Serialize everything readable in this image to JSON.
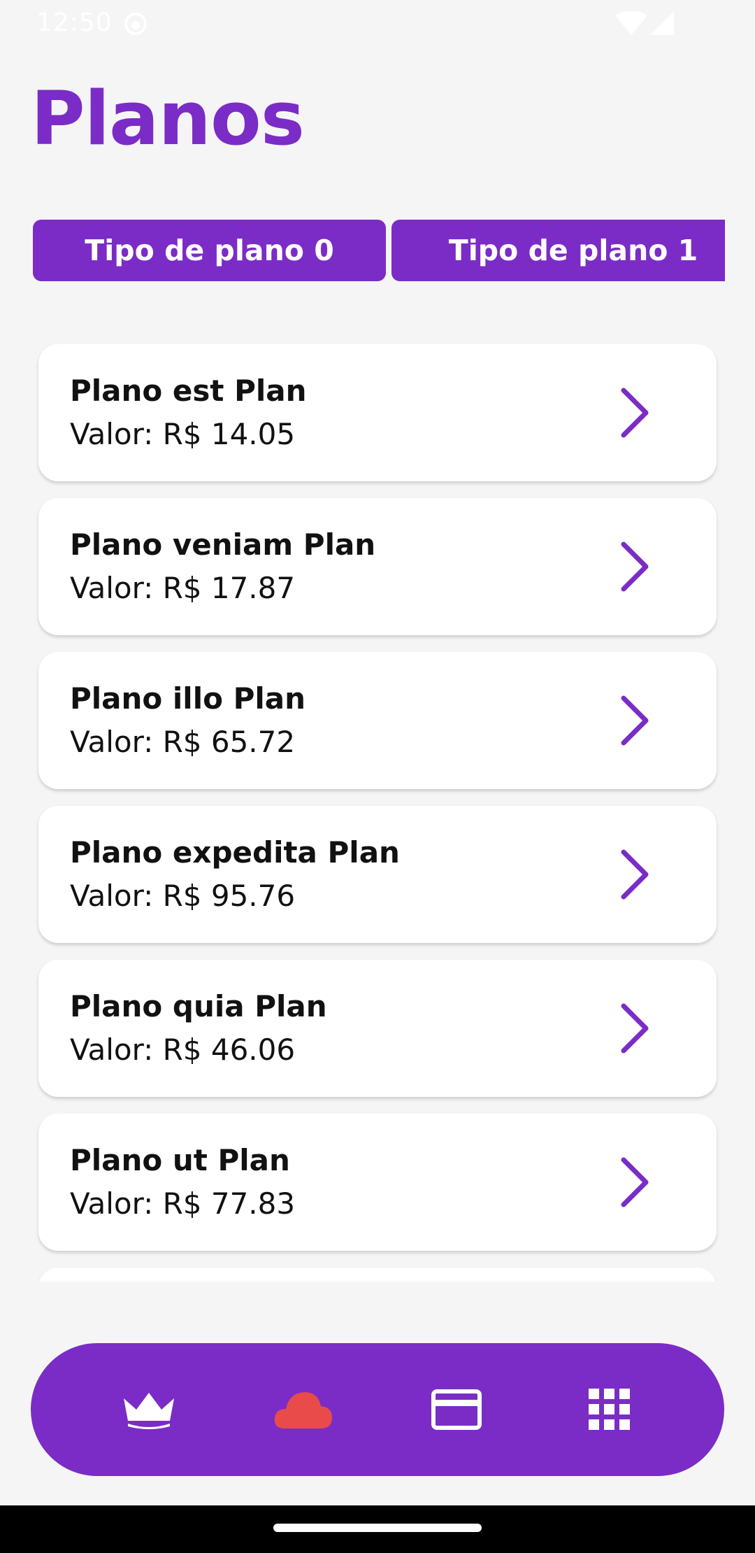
{
  "status_bar": {
    "time": "12:50",
    "icons": [
      "app-notification-icon",
      "wifi-icon",
      "cell-signal-icon"
    ]
  },
  "page": {
    "title": "Planos"
  },
  "tabs": [
    {
      "label": "Tipo de plano 0"
    },
    {
      "label": "Tipo de plano 1"
    }
  ],
  "plans": [
    {
      "name": "Plano est Plan",
      "price": "Valor: R$ 14.05"
    },
    {
      "name": "Plano veniam Plan",
      "price": "Valor: R$ 17.87"
    },
    {
      "name": "Plano illo Plan",
      "price": "Valor: R$ 65.72"
    },
    {
      "name": "Plano expedita Plan",
      "price": "Valor: R$ 95.76"
    },
    {
      "name": "Plano quia Plan",
      "price": "Valor: R$ 46.06"
    },
    {
      "name": "Plano ut Plan",
      "price": "Valor: R$ 77.83"
    }
  ],
  "bottom_nav": {
    "items": [
      {
        "icon": "crown-icon",
        "color": "#ffffff"
      },
      {
        "icon": "cloud-icon",
        "color": "#e94b4b"
      },
      {
        "icon": "credit-card-icon",
        "color": "#ffffff"
      },
      {
        "icon": "grid-icon",
        "color": "#ffffff"
      }
    ]
  },
  "colors": {
    "accent": "#7b2cc6",
    "background": "#f5f5f5",
    "card": "#ffffff",
    "active_nav": "#e94b4b"
  }
}
